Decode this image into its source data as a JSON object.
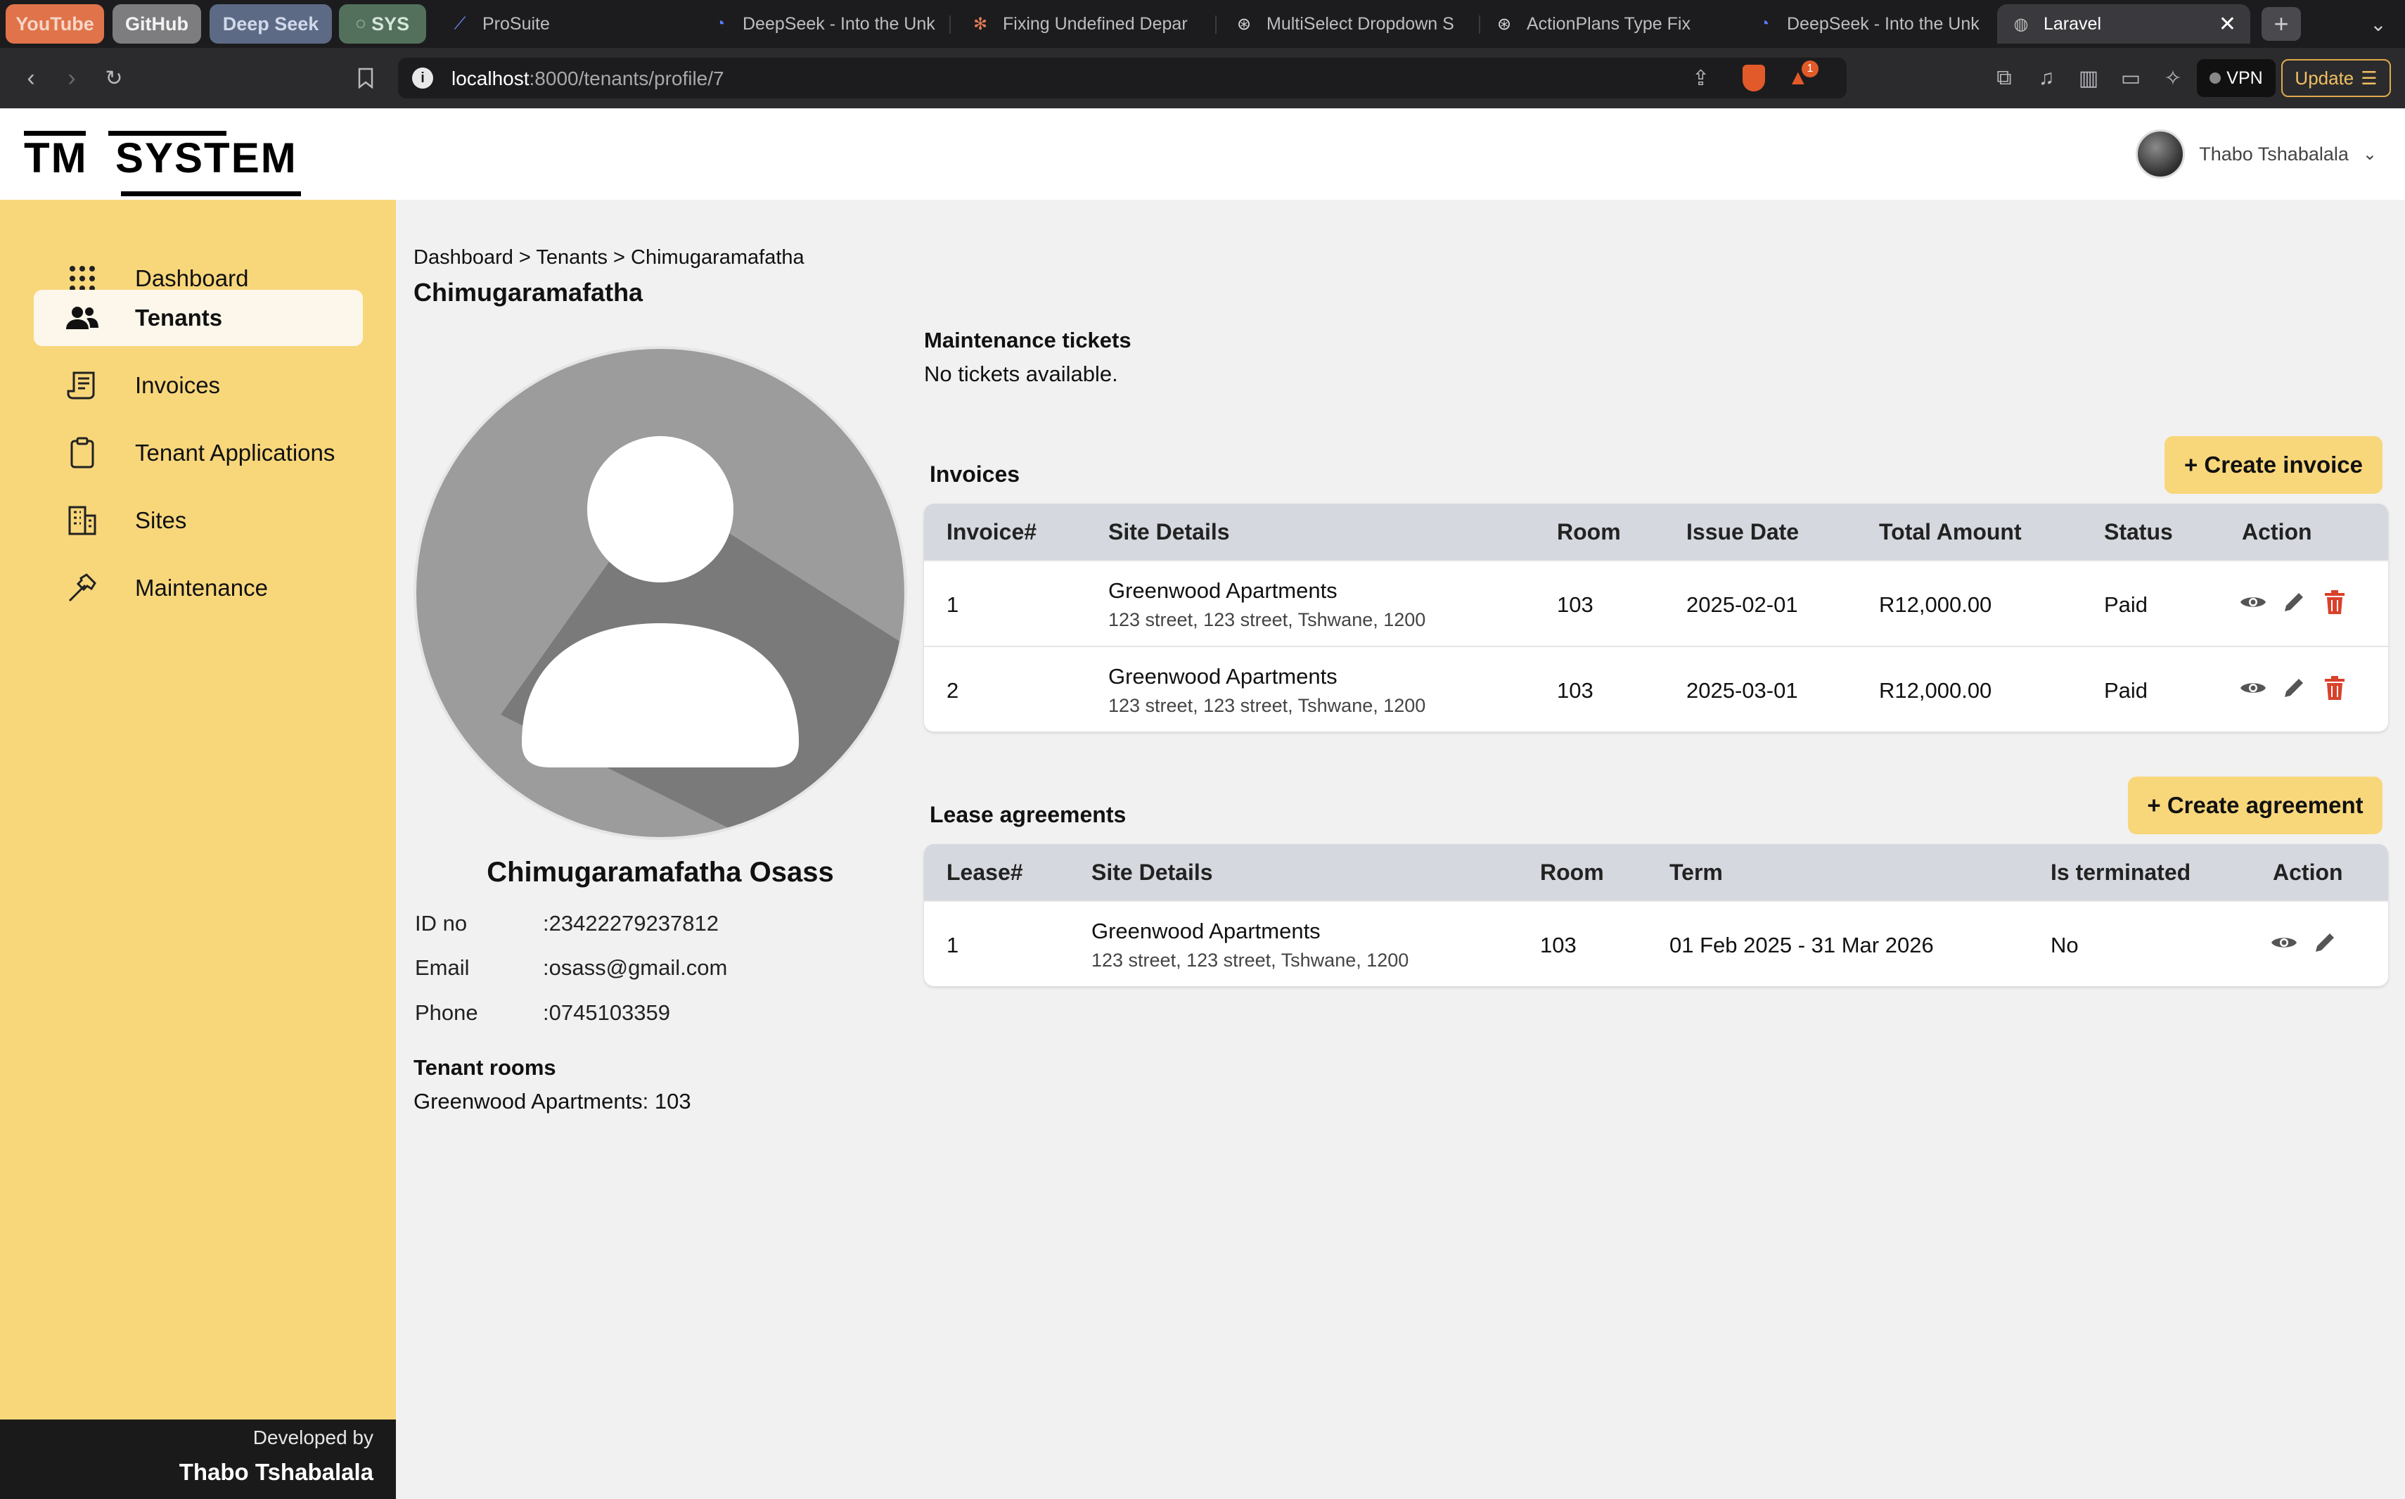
{
  "browser": {
    "pinned_tabs": [
      "YouTube",
      "GitHub",
      "Deep Seek",
      "SYS"
    ],
    "tabs": [
      {
        "label": "ProSuite"
      },
      {
        "label": "DeepSeek - Into the Unk"
      },
      {
        "label": "Fixing Undefined Depar"
      },
      {
        "label": "MultiSelect Dropdown S"
      },
      {
        "label": "ActionPlans Type Fix"
      },
      {
        "label": "DeepSeek - Into the Unk"
      },
      {
        "label": "Laravel"
      }
    ],
    "url_host": "localhost",
    "url_path": ":8000/tenants/profile/7",
    "notification_count": "1",
    "vpn_label": "VPN",
    "update_label": "Update"
  },
  "app": {
    "logo_left": "TM",
    "logo_right": "SYSTEM",
    "user_name": "Thabo Tshabalala"
  },
  "sidebar": {
    "items": [
      {
        "label": "Dashboard"
      },
      {
        "label": "Tenants"
      },
      {
        "label": "Invoices"
      },
      {
        "label": "Tenant Applications"
      },
      {
        "label": "Sites"
      },
      {
        "label": "Maintenance"
      }
    ],
    "footer_line1": "Developed by",
    "footer_line2": "Thabo Tshabalala"
  },
  "breadcrumb": [
    "Dashboard",
    "Tenants",
    "Chimugaramafatha"
  ],
  "breadcrumb_sep": " > ",
  "page_title": "Chimugaramafatha",
  "tenant": {
    "full_name": "Chimugaramafatha Osass",
    "fields": [
      {
        "key": "ID no",
        "value": ":23422279237812"
      },
      {
        "key": "Email",
        "value": ":osass@gmail.com"
      },
      {
        "key": "Phone",
        "value": ":0745103359"
      }
    ],
    "rooms_title": "Tenant rooms",
    "rooms_text": "Greenwood Apartments: 103"
  },
  "maintenance": {
    "title": "Maintenance tickets",
    "empty": "No tickets available."
  },
  "invoices": {
    "title": "Invoices",
    "create_label": "+ Create invoice",
    "headers": [
      "Invoice#",
      "Site Details",
      "Room",
      "Issue Date",
      "Total Amount",
      "Status",
      "Action"
    ],
    "rows": [
      {
        "number": "1",
        "site": "Greenwood Apartments",
        "address": "123 street, 123 street, Tshwane, 1200",
        "room": "103",
        "date": "2025-02-01",
        "amount": "R12,000.00",
        "status": "Paid"
      },
      {
        "number": "2",
        "site": "Greenwood Apartments",
        "address": "123 street, 123 street, Tshwane, 1200",
        "room": "103",
        "date": "2025-03-01",
        "amount": "R12,000.00",
        "status": "Paid"
      }
    ]
  },
  "leases": {
    "title": "Lease agreements",
    "create_label": "+ Create agreement",
    "headers": [
      "Lease#",
      "Site Details",
      "Room",
      "Term",
      "Is terminated",
      "Action"
    ],
    "rows": [
      {
        "number": "1",
        "site": "Greenwood Apartments",
        "address": "123 street, 123 street, Tshwane, 1200",
        "room": "103",
        "term": "01 Feb 2025 - 31 Mar 2026",
        "terminated": "No"
      }
    ]
  },
  "colors": {
    "accent": "#f8d77b",
    "danger": "#d9412b",
    "sidebar_footer": "#1a1a1a"
  }
}
